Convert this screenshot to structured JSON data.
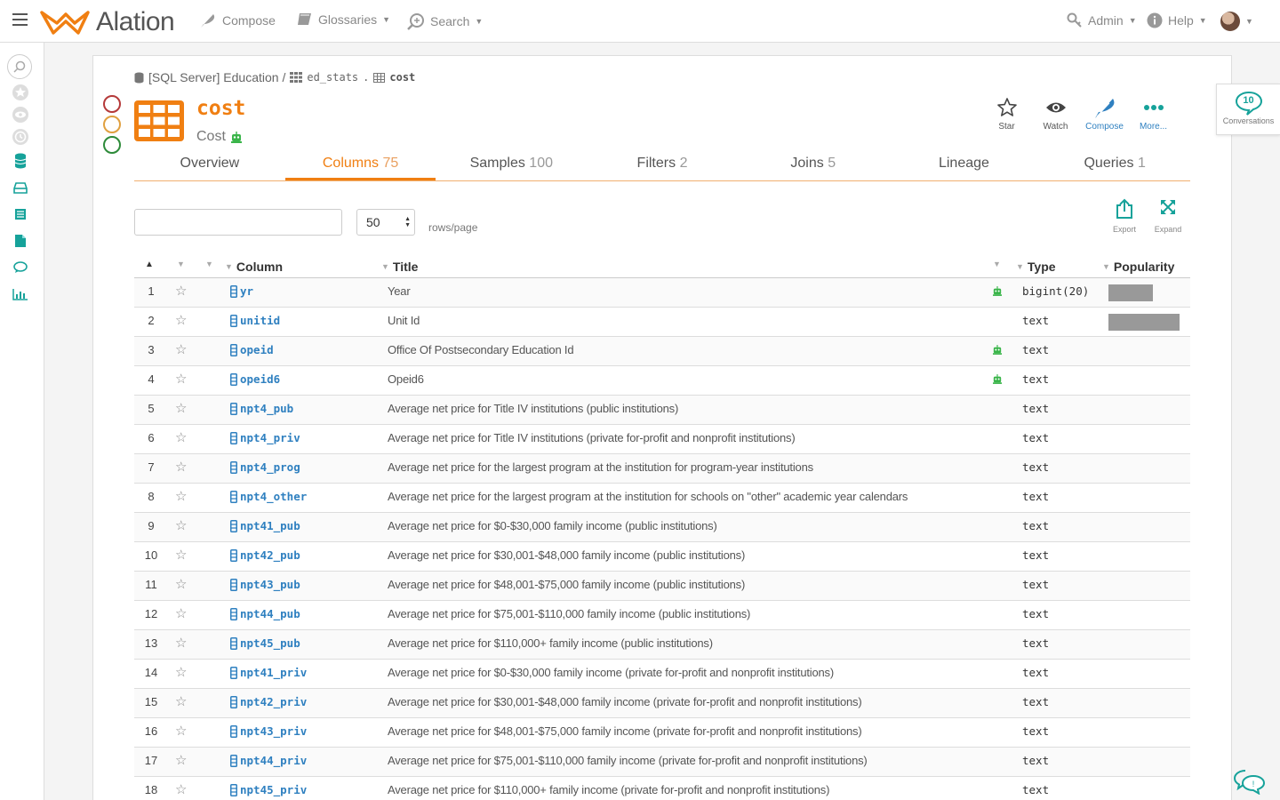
{
  "app": {
    "name": "Alation"
  },
  "nav": {
    "compose": "Compose",
    "glossaries": "Glossaries",
    "search": "Search",
    "admin": "Admin",
    "help": "Help"
  },
  "breadcrumb": {
    "datasource": "[SQL Server] Education /",
    "schema": "ed_stats",
    "sep": ".",
    "table": "cost"
  },
  "object": {
    "name": "cost",
    "title": "Cost"
  },
  "actions": {
    "star": "Star",
    "watch": "Watch",
    "compose": "Compose",
    "more": "More..."
  },
  "tabs": [
    {
      "label": "Overview",
      "count": ""
    },
    {
      "label": "Columns",
      "count": "75"
    },
    {
      "label": "Samples",
      "count": "100"
    },
    {
      "label": "Filters",
      "count": "2"
    },
    {
      "label": "Joins",
      "count": "5"
    },
    {
      "label": "Lineage",
      "count": ""
    },
    {
      "label": "Queries",
      "count": "1"
    }
  ],
  "filter": {
    "placeholder": "",
    "rows_value": "50",
    "rows_label": "rows/page"
  },
  "tools": {
    "export": "Export",
    "expand": "Expand"
  },
  "table": {
    "headers": {
      "column": "Column",
      "title": "Title",
      "type": "Type",
      "popularity": "Popularity"
    },
    "rows": [
      {
        "idx": "1",
        "name": "yr",
        "title": "Year",
        "bot": true,
        "type": "bigint(20)",
        "popularity": 0.62
      },
      {
        "idx": "2",
        "name": "unitid",
        "title": "Unit Id",
        "bot": false,
        "type": "text",
        "popularity": 1.0
      },
      {
        "idx": "3",
        "name": "opeid",
        "title": "Office Of Postsecondary Education Id",
        "bot": true,
        "type": "text",
        "popularity": 0
      },
      {
        "idx": "4",
        "name": "opeid6",
        "title": "Opeid6",
        "bot": true,
        "type": "text",
        "popularity": 0
      },
      {
        "idx": "5",
        "name": "npt4_pub",
        "title": "Average net price for Title IV institutions (public institutions)",
        "bot": false,
        "type": "text",
        "popularity": 0
      },
      {
        "idx": "6",
        "name": "npt4_priv",
        "title": "Average net price for Title IV institutions (private for-profit and nonprofit institutions)",
        "bot": false,
        "type": "text",
        "popularity": 0
      },
      {
        "idx": "7",
        "name": "npt4_prog",
        "title": "Average net price for the largest program at the institution for program-year institutions",
        "bot": false,
        "type": "text",
        "popularity": 0
      },
      {
        "idx": "8",
        "name": "npt4_other",
        "title": "Average net price for the largest program at the institution for schools on \"other\" academic year calendars",
        "bot": false,
        "type": "text",
        "popularity": 0
      },
      {
        "idx": "9",
        "name": "npt41_pub",
        "title": "Average net price for $0-$30,000 family income (public institutions)",
        "bot": false,
        "type": "text",
        "popularity": 0
      },
      {
        "idx": "10",
        "name": "npt42_pub",
        "title": "Average net price for $30,001-$48,000 family income (public institutions)",
        "bot": false,
        "type": "text",
        "popularity": 0
      },
      {
        "idx": "11",
        "name": "npt43_pub",
        "title": "Average net price for $48,001-$75,000 family income (public institutions)",
        "bot": false,
        "type": "text",
        "popularity": 0
      },
      {
        "idx": "12",
        "name": "npt44_pub",
        "title": "Average net price for $75,001-$110,000 family income (public institutions)",
        "bot": false,
        "type": "text",
        "popularity": 0
      },
      {
        "idx": "13",
        "name": "npt45_pub",
        "title": "Average net price for $110,000+ family income (public institutions)",
        "bot": false,
        "type": "text",
        "popularity": 0
      },
      {
        "idx": "14",
        "name": "npt41_priv",
        "title": "Average net price for $0-$30,000 family income (private for-profit and nonprofit institutions)",
        "bot": false,
        "type": "text",
        "popularity": 0
      },
      {
        "idx": "15",
        "name": "npt42_priv",
        "title": "Average net price for $30,001-$48,000 family income (private for-profit and nonprofit institutions)",
        "bot": false,
        "type": "text",
        "popularity": 0
      },
      {
        "idx": "16",
        "name": "npt43_priv",
        "title": "Average net price for $48,001-$75,000 family income (private for-profit and nonprofit institutions)",
        "bot": false,
        "type": "text",
        "popularity": 0
      },
      {
        "idx": "17",
        "name": "npt44_priv",
        "title": "Average net price for $75,001-$110,000 family income (private for-profit and nonprofit institutions)",
        "bot": false,
        "type": "text",
        "popularity": 0
      },
      {
        "idx": "18",
        "name": "npt45_priv",
        "title": "Average net price for $110,000+ family income (private for-profit and nonprofit institutions)",
        "bot": false,
        "type": "text",
        "popularity": 0
      }
    ]
  },
  "conversations": {
    "count": "10",
    "label": "Conversations"
  },
  "colors": {
    "accent": "#f07f12",
    "link": "#2f80c0",
    "teal": "#16a29a",
    "bot": "#3ab54a"
  }
}
